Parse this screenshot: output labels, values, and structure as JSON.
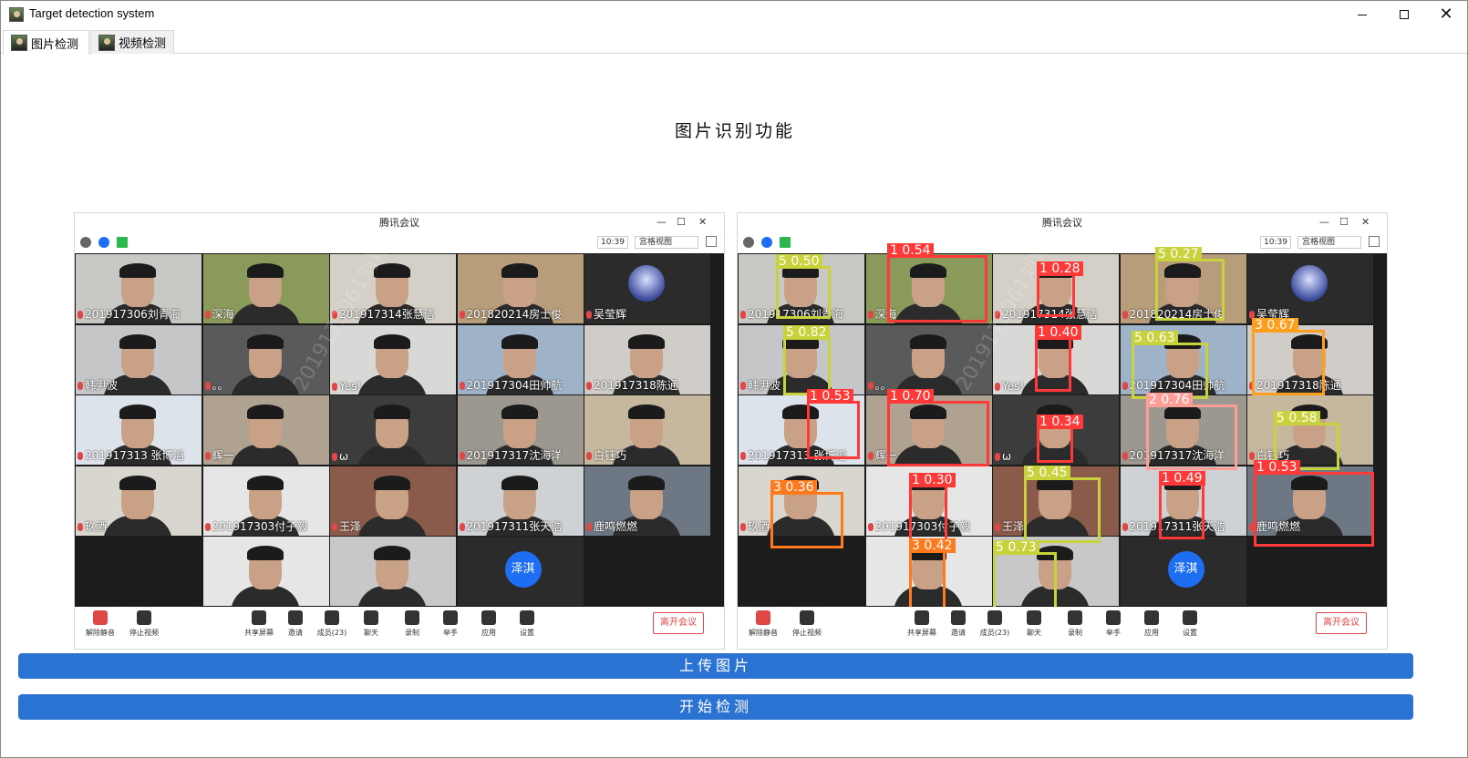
{
  "window": {
    "title": "Target detection system"
  },
  "tabs": [
    {
      "label": "图片检测",
      "active": true
    },
    {
      "label": "视频检测",
      "active": false
    }
  ],
  "heading": "图片识别功能",
  "meeting": {
    "title": "腾讯会议",
    "time": "10:39",
    "view_mode": "宫格视图",
    "watermark": "2019173061刘青海 8662",
    "leave_label": "离开会议",
    "bottom_bar": [
      "解除静音",
      "停止视频",
      "共享屏幕",
      "邀请",
      "成员(23)",
      "聊天",
      "录制",
      "举手",
      "应用",
      "设置"
    ],
    "tiles": [
      {
        "name": "201917306刘青海",
        "kind": "face",
        "bg": "#c8c8c4"
      },
      {
        "name": "深海",
        "kind": "face",
        "bg": "#8a9a5a"
      },
      {
        "name": "201917314张慧洁",
        "kind": "face",
        "bg": "#d4d0c8"
      },
      {
        "name": "201820214房士俊",
        "kind": "face",
        "bg": "#b89d7a"
      },
      {
        "name": "吴莹辉",
        "kind": "anime",
        "bg": "#2b2b2b"
      },
      {
        "name": "韩尹波",
        "kind": "face",
        "bg": "#c5c6c8"
      },
      {
        "name": "。。",
        "kind": "face",
        "bg": "#5a5a5a"
      },
      {
        "name": "Yes!",
        "kind": "face",
        "bg": "#d8d8d6"
      },
      {
        "name": "201917304田帅航",
        "kind": "face",
        "bg": "#9fb3c8"
      },
      {
        "name": "201917318陈通",
        "kind": "face",
        "bg": "#d0cdc8"
      },
      {
        "name": "201917313 张博滔",
        "kind": "face",
        "bg": "#dde3ea"
      },
      {
        "name": "辉一",
        "kind": "face",
        "bg": "#b0a290"
      },
      {
        "name": "ω",
        "kind": "face",
        "bg": "#3c3c3c"
      },
      {
        "name": "201917317沈海洋",
        "kind": "face",
        "bg": "#9c9890"
      },
      {
        "name": "白钰巧",
        "kind": "face",
        "bg": "#c6b89e"
      },
      {
        "name": "玖酒",
        "kind": "face",
        "bg": "#d9d6cf"
      },
      {
        "name": "201917303付子毅",
        "kind": "face",
        "bg": "#e6e6e6"
      },
      {
        "name": "王泽",
        "kind": "face",
        "bg": "#8a5a4a"
      },
      {
        "name": "201917311张天浩",
        "kind": "face",
        "bg": "#cfd2d4"
      },
      {
        "name": "鹿鸣燃燃",
        "kind": "face",
        "bg": "#6e7884"
      },
      {
        "name": "",
        "kind": "empty",
        "bg": "#1c1c1c"
      },
      {
        "name": "",
        "kind": "face",
        "bg": "#e6e6e6"
      },
      {
        "name": "",
        "kind": "face",
        "bg": "#c8c8c8"
      },
      {
        "name": "泽淇",
        "kind": "avatar",
        "bg": "#2b2b2b"
      },
      {
        "name": "",
        "kind": "empty",
        "bg": "#1c1c1c"
      }
    ]
  },
  "detections": [
    {
      "label": "5 0.50",
      "color": "#c8d23a"
    },
    {
      "label": "1 0.54",
      "color": "#ff3838"
    },
    {
      "label": "1 0.28",
      "color": "#ff3838"
    },
    {
      "label": "5 0.27",
      "color": "#c8d23a"
    },
    {
      "label": "5 0.82",
      "color": "#c8d23a"
    },
    {
      "label": "1 0.40",
      "color": "#ff3838"
    },
    {
      "label": "5 0.63",
      "color": "#c8d23a"
    },
    {
      "label": "3 0.67",
      "color": "#ff9d1c"
    },
    {
      "label": "1 0.53",
      "color": "#ff3838"
    },
    {
      "label": "1 0.70",
      "color": "#ff3838"
    },
    {
      "label": "1 0.34",
      "color": "#ff3838"
    },
    {
      "label": "2 0.76",
      "color": "#ff9d97"
    },
    {
      "label": "5 0.58",
      "color": "#c8d23a"
    },
    {
      "label": "3 0.36",
      "color": "#ff7a1c"
    },
    {
      "label": "1 0.30",
      "color": "#ff3838"
    },
    {
      "label": "5 0.45",
      "color": "#c8d23a"
    },
    {
      "label": "1 0.49",
      "color": "#ff3838"
    },
    {
      "label": "1 0.53",
      "color": "#ff3838"
    },
    {
      "label": "3 0.42",
      "color": "#ff7a1c"
    },
    {
      "label": "5 0.73",
      "color": "#c8d23a"
    }
  ],
  "buttons": {
    "upload": "上传图片",
    "detect": "开始检测"
  }
}
